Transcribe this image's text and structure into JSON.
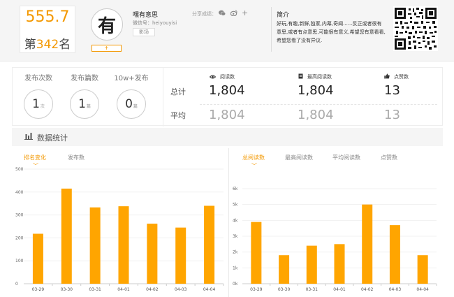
{
  "header": {
    "score": "555.7",
    "rank_prefix": "第",
    "rank_num": "342",
    "rank_suffix": "名",
    "avatar_char": "有",
    "plus": "+",
    "account_name": "嘿有意思",
    "account_id": "微信号：heiyouyisi",
    "account_tag": "影场",
    "share_label": "分享成绩：",
    "intro_title": "简介",
    "intro_text": "好玩,有趣,新鲜,独家,内幕,奇闻......反正或者很有意思,或者有点意思,可能很有意义,希望您有意看看,希望您看了没有异议."
  },
  "stats": {
    "items": [
      {
        "label": "发布次数",
        "value": "1",
        "unit": "次"
      },
      {
        "label": "发布篇数",
        "value": "1",
        "unit": "篇"
      },
      {
        "label": "10w+发布",
        "value": "0",
        "unit": "篇"
      }
    ],
    "row_total": "总计",
    "row_avg": "平均",
    "columns": [
      {
        "icon": "eye-icon",
        "label": "阅读数",
        "total": "1,804",
        "avg": "1,804"
      },
      {
        "icon": "doc-icon",
        "label": "最高阅读数",
        "total": "1,804",
        "avg": "1,804"
      },
      {
        "icon": "thumb-icon",
        "label": "点赞数",
        "total": "13",
        "avg": "13"
      }
    ]
  },
  "section": {
    "title": "数据统计"
  },
  "left_panel": {
    "tabs": [
      "排名变化",
      "发布数"
    ],
    "active_tab": 0
  },
  "right_panel": {
    "tabs": [
      "总阅读数",
      "最高阅读数",
      "平均阅读数",
      "点赞数"
    ],
    "active_tab": 0
  },
  "colors": {
    "accent": "#f39800",
    "bar": "#ffa500"
  },
  "chart_data": [
    {
      "type": "bar",
      "categories": [
        "03-29",
        "03-30",
        "03-31",
        "04-01",
        "04-02",
        "04-03",
        "04-04"
      ],
      "values": [
        218,
        415,
        333,
        338,
        262,
        245,
        340
      ],
      "yticks": [
        "0",
        "100",
        "200",
        "300",
        "400",
        "500"
      ],
      "ylim": [
        0,
        500
      ]
    },
    {
      "type": "bar",
      "categories": [
        "03-29",
        "03-30",
        "03-31",
        "04-01",
        "04-02",
        "04-03",
        "04-04"
      ],
      "values": [
        3900,
        1800,
        2400,
        2500,
        5000,
        3700,
        1800
      ],
      "yticks": [
        "0k",
        "1k",
        "2k",
        "3k",
        "4k",
        "5k",
        "6k"
      ],
      "ylim": [
        0,
        6000
      ]
    }
  ]
}
